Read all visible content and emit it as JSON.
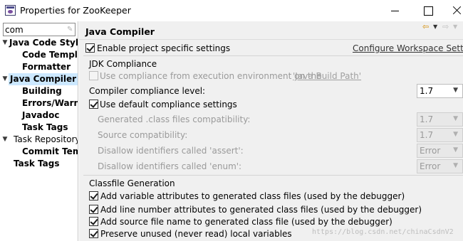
{
  "window": {
    "title": "Properties for ZooKeeper",
    "app_icon": "eclipse-properties-icon"
  },
  "filter": {
    "value": "com",
    "clear_icon": "clear-filter-icon"
  },
  "tree": [
    {
      "label": "Java Code Style",
      "bold": true,
      "expanded": true,
      "level": 0
    },
    {
      "label": "Code Templat",
      "bold": true,
      "level": 1
    },
    {
      "label": "Formatter",
      "bold": true,
      "level": 1
    },
    {
      "label": "Java Compiler",
      "bold": true,
      "expanded": true,
      "level": 0,
      "selected": true
    },
    {
      "label": "Building",
      "bold": true,
      "level": 1
    },
    {
      "label": "Errors/Warnir",
      "bold": true,
      "level": 1
    },
    {
      "label": "Javadoc",
      "bold": true,
      "level": 1
    },
    {
      "label": "Task Tags",
      "bold": true,
      "level": 1
    },
    {
      "label": "Task Repository",
      "bold": false,
      "expanded": true,
      "level": 0
    },
    {
      "label": "Commit Temp",
      "bold": true,
      "level": 1
    },
    {
      "label": "Task Tags",
      "bold": true,
      "level": 0
    }
  ],
  "page": {
    "title": "Java Compiler",
    "nav": {
      "back": "back-arrow-icon",
      "forward": "forward-arrow-icon"
    }
  },
  "project_specific": {
    "label": "Enable project specific settings",
    "checked": true,
    "workspace_link": "Configure Workspace Setting"
  },
  "jdk": {
    "group_label": "JDK Compliance",
    "use_compliance_prefix": "Use compliance from execution environment on the ",
    "use_compliance_link": "'Java Build Path'",
    "compliance_label": "Compiler compliance level:",
    "compliance_value": "1.7",
    "use_default_label": "Use default compliance settings",
    "generated_label": "Generated .class files compatibility:",
    "generated_value": "1.7",
    "source_label": "Source compatibility:",
    "source_value": "1.7",
    "assert_label": "Disallow identifiers called 'assert':",
    "assert_value": "Error",
    "enum_label": "Disallow identifiers called 'enum':",
    "enum_value": "Error"
  },
  "classfile": {
    "group_label": "Classfile Generation",
    "options": [
      "Add variable attributes to generated class files (used by the debugger)",
      "Add line number attributes to generated class files (used by the debugger)",
      "Add source file name to generated class file (used by the debugger)",
      "Preserve unused (never read) local variables"
    ]
  },
  "watermark": "https://blog.csdn.net/chinaCsdnV2"
}
